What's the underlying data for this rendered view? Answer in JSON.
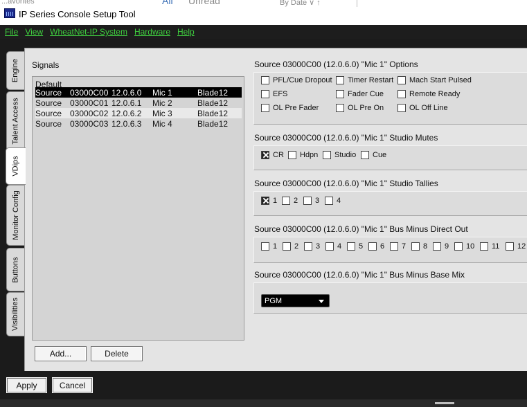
{
  "background_ghost": {
    "left_text": "...avorites",
    "all": "All",
    "unread": "Unread",
    "bydate": "By Date ∨  ↑"
  },
  "app": {
    "title": "IP Series Console Setup Tool",
    "accent_color": "#3fcf3f"
  },
  "menu": [
    "File",
    "View",
    "WheatNet-IP System",
    "Hardware",
    "Help"
  ],
  "tabs": [
    {
      "label": "Engine",
      "active": false
    },
    {
      "label": "Talent Access",
      "active": false
    },
    {
      "label": "VDips",
      "active": true
    },
    {
      "label": "Monitor Config",
      "active": false
    },
    {
      "label": "Buttons",
      "active": false
    },
    {
      "label": "Visibilities",
      "active": false
    }
  ],
  "signals": {
    "label": "Signals",
    "default_label": "Default",
    "rows": [
      {
        "type": "Source",
        "id": "03000C00",
        "ip": "12.0.6.0",
        "name": "Mic 1",
        "blade": "Blade12",
        "selected": true
      },
      {
        "type": "Source",
        "id": "03000C01",
        "ip": "12.0.6.1",
        "name": "Mic 2",
        "blade": "Blade12",
        "selected": false
      },
      {
        "type": "Source",
        "id": "03000C02",
        "ip": "12.0.6.2",
        "name": "Mic 3",
        "blade": "Blade12",
        "selected": false
      },
      {
        "type": "Source",
        "id": "03000C03",
        "ip": "12.0.6.3",
        "name": "Mic 4",
        "blade": "Blade12",
        "selected": false
      }
    ],
    "add_button": "Add...",
    "delete_button": "Delete"
  },
  "options": {
    "title": "Source 03000C00 (12.0.6.0) \"Mic 1\" Options",
    "items": [
      {
        "label": "PFL/Cue Dropout",
        "checked": false
      },
      {
        "label": "Timer Restart",
        "checked": false
      },
      {
        "label": "Mach Start Pulsed",
        "checked": false
      },
      {
        "label": "EFS",
        "checked": false
      },
      {
        "label": "Fader Cue",
        "checked": false
      },
      {
        "label": "Remote Ready",
        "checked": false
      },
      {
        "label": "OL Pre Fader",
        "checked": false
      },
      {
        "label": "OL Pre On",
        "checked": false
      },
      {
        "label": "OL Off Line",
        "checked": false
      }
    ]
  },
  "studio_mutes": {
    "title": "Source 03000C00 (12.0.6.0) \"Mic 1\" Studio Mutes",
    "items": [
      {
        "label": "CR",
        "checked": true
      },
      {
        "label": "Hdpn",
        "checked": false
      },
      {
        "label": "Studio",
        "checked": false
      },
      {
        "label": "Cue",
        "checked": false
      }
    ]
  },
  "studio_tallies": {
    "title": "Source 03000C00 (12.0.6.0) \"Mic 1\" Studio Tallies",
    "items": [
      {
        "label": "1",
        "checked": true
      },
      {
        "label": "2",
        "checked": false
      },
      {
        "label": "3",
        "checked": false
      },
      {
        "label": "4",
        "checked": false
      }
    ]
  },
  "bus_minus_direct": {
    "title": "Source 03000C00 (12.0.6.0) \"Mic 1\" Bus Minus Direct Out",
    "items": [
      "1",
      "2",
      "3",
      "4",
      "5",
      "6",
      "7",
      "8",
      "9",
      "10",
      "11",
      "12"
    ]
  },
  "bus_minus_base": {
    "title": "Source 03000C00 (12.0.6.0) \"Mic 1\" Bus Minus Base Mix",
    "selected": "PGM"
  },
  "footer": {
    "apply": "Apply",
    "cancel": "Cancel"
  }
}
